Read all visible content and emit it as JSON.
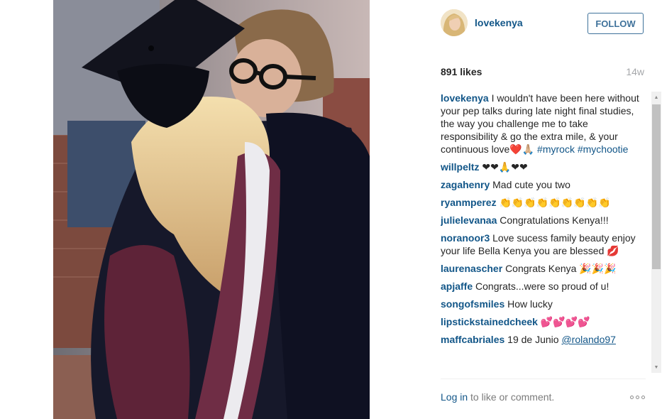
{
  "post": {
    "username": "lovekenya",
    "follow_label": "FOLLOW",
    "likes": "891 likes",
    "age": "14w"
  },
  "comments": [
    {
      "author": "lovekenya",
      "text": "I wouldn't have been here without your pep talks during late night final studies, the way you challenge me to take responsibility & go the extra mile, & your continuous love❤️🙏🏼",
      "hashtags": "#myrock #mychootie"
    },
    {
      "author": "willpeltz",
      "text": "❤❤🙏❤❤"
    },
    {
      "author": "zagahenry",
      "text": "Mad cute you two"
    },
    {
      "author": "ryanmperez",
      "text": "👏👏👏👏👏👏👏👏👏"
    },
    {
      "author": "julielevanaa",
      "text": "Congratulations Kenya!!!"
    },
    {
      "author": "noranoor3",
      "text": "Love sucess family beauty enjoy your life Bella Kenya you are blessed 💋"
    },
    {
      "author": "laurenascher",
      "text": "Congrats Kenya 🎉🎉🎉"
    },
    {
      "author": "apjaffe",
      "text": "Congrats...were so proud of u!"
    },
    {
      "author": "songofsmiles",
      "text": "How lucky"
    },
    {
      "author": "lipstickstainedcheek",
      "text": "💕💕💕💕"
    },
    {
      "author": "maffcabriales",
      "text": "19 de Junio",
      "mention": "@rolando97"
    }
  ],
  "footer": {
    "login_label": "Log in",
    "rest_text": " to like or comment."
  },
  "icons": {
    "more": "more-options-icon",
    "scroll_up": "scroll-up-arrow-icon",
    "scroll_down": "scroll-down-arrow-icon"
  },
  "colors": {
    "link_blue": "#125688",
    "follow_blue": "#3f729b",
    "muted_gray": "#a5a7aa"
  }
}
